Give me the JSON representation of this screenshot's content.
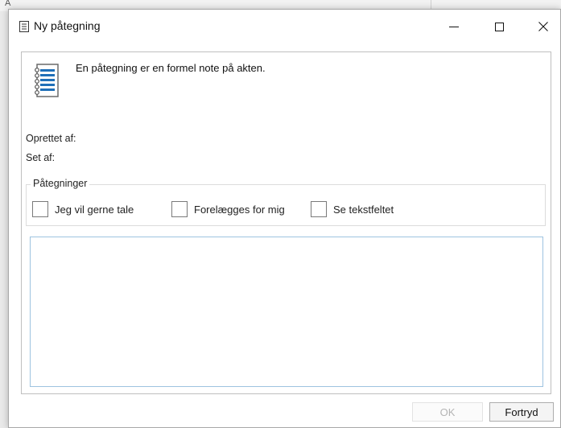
{
  "background": {
    "letter": "A"
  },
  "window": {
    "title": "Ny påtegning",
    "controls": {
      "minimize": "minimize",
      "maximize": "maximize",
      "close": "close"
    }
  },
  "content": {
    "intro": "En påtegning er en formel note på akten.",
    "created_by_label": "Oprettet af:",
    "seen_by_label": "Set af:",
    "group": {
      "legend": "Påtegninger",
      "options": [
        {
          "label": "Jeg vil gerne tale",
          "checked": false
        },
        {
          "label": "Forelægges for mig",
          "checked": false
        },
        {
          "label": "Se tekstfeltet",
          "checked": false
        }
      ]
    },
    "note_text": ""
  },
  "buttons": {
    "ok": "OK",
    "cancel": "Fortryd"
  },
  "colors": {
    "accent_border": "#9ec3e0",
    "icon_blue": "#1f6fb8",
    "disabled_text": "#b4b4b4"
  }
}
